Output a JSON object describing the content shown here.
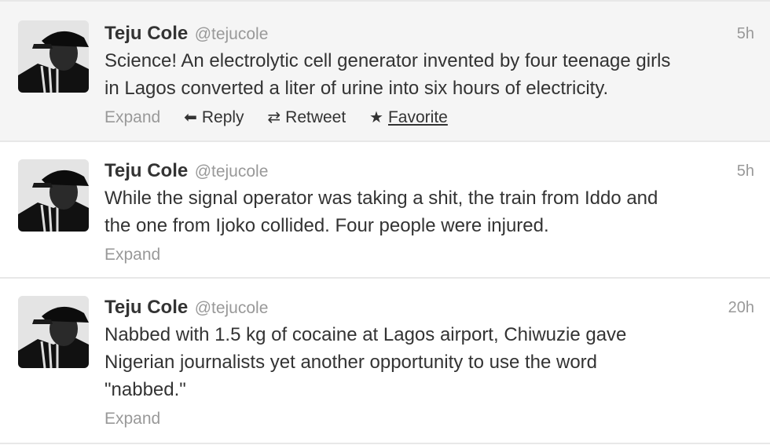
{
  "tweets": [
    {
      "name": "Teju Cole",
      "handle": "@tejucole",
      "time": "5h",
      "text": "Science! An electrolytic cell generator invented by four teenage girls\nin Lagos converted a liter of urine into six hours of electricity.",
      "hovered": true,
      "actions": {
        "expand": "Expand",
        "reply": "Reply",
        "retweet": "Retweet",
        "favorite": "Favorite"
      }
    },
    {
      "name": "Teju Cole",
      "handle": "@tejucole",
      "time": "5h",
      "text": "While the signal operator was taking a shit, the train from Iddo and\nthe one from Ijoko collided. Four people were injured.",
      "hovered": false,
      "actions": {
        "expand": "Expand"
      }
    },
    {
      "name": "Teju Cole",
      "handle": "@tejucole",
      "time": "20h",
      "text": "Nabbed with 1.5 kg of cocaine at Lagos airport, Chiwuzie gave\nNigerian journalists yet another opportunity to use the word\n\"nabbed.\"",
      "hovered": false,
      "actions": {
        "expand": "Expand"
      }
    }
  ],
  "icons": {
    "reply": "reply-arrow-icon",
    "retweet": "retweet-icon",
    "favorite": "star-icon"
  }
}
